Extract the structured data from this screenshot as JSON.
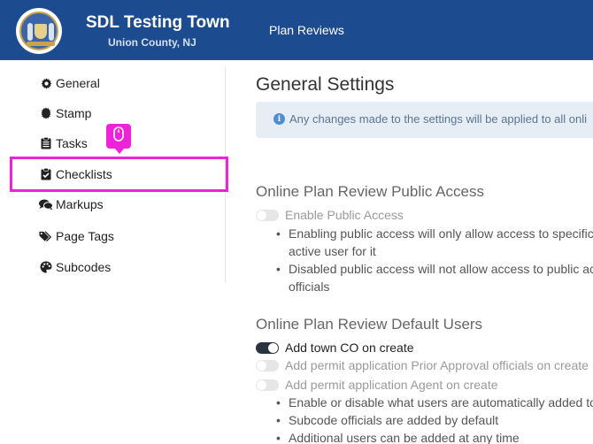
{
  "header": {
    "app_title": "SDL Testing Town",
    "app_subtitle": "Union County, NJ",
    "nav_plan_reviews": "Plan Reviews",
    "brand_color": "#1c4b8f"
  },
  "sidebar": {
    "items": [
      {
        "label": "General",
        "icon": "gear-icon"
      },
      {
        "label": "Stamp",
        "icon": "stamp-icon"
      },
      {
        "label": "Tasks",
        "icon": "clipboard-list-icon"
      },
      {
        "label": "Checklists",
        "icon": "clipboard-check-icon"
      },
      {
        "label": "Markups",
        "icon": "comments-icon"
      },
      {
        "label": "Page Tags",
        "icon": "tags-icon"
      },
      {
        "label": "Subcodes",
        "icon": "palette-icon"
      }
    ],
    "highlighted_item": "Checklists",
    "highlight_color": "#ee22d9",
    "click_indicator_icon": "mouse-icon"
  },
  "main": {
    "title": "General Settings",
    "info_text": "Any changes made to the settings will be applied to all onli",
    "public_access": {
      "title": "Online Plan Review Public Access",
      "toggle_label": "Enable Public Access",
      "toggle_on": false,
      "bullets": [
        [
          "Enabling public access will only allow access to specific pla",
          "active user for it"
        ],
        [
          "Disabled public access will not allow access to public acco",
          "officials"
        ]
      ]
    },
    "default_users": {
      "title": "Online Plan Review Default Users",
      "toggles": [
        {
          "label": "Add town CO on create",
          "on": true
        },
        {
          "label": "Add permit application Prior Approval officials on create",
          "on": false
        },
        {
          "label": "Add permit application Agent on create",
          "on": false
        }
      ],
      "bullets": [
        "Enable or disable what users are automatically added to a",
        "Subcode officials are added by default",
        "Additional users can be added at any time"
      ]
    }
  }
}
